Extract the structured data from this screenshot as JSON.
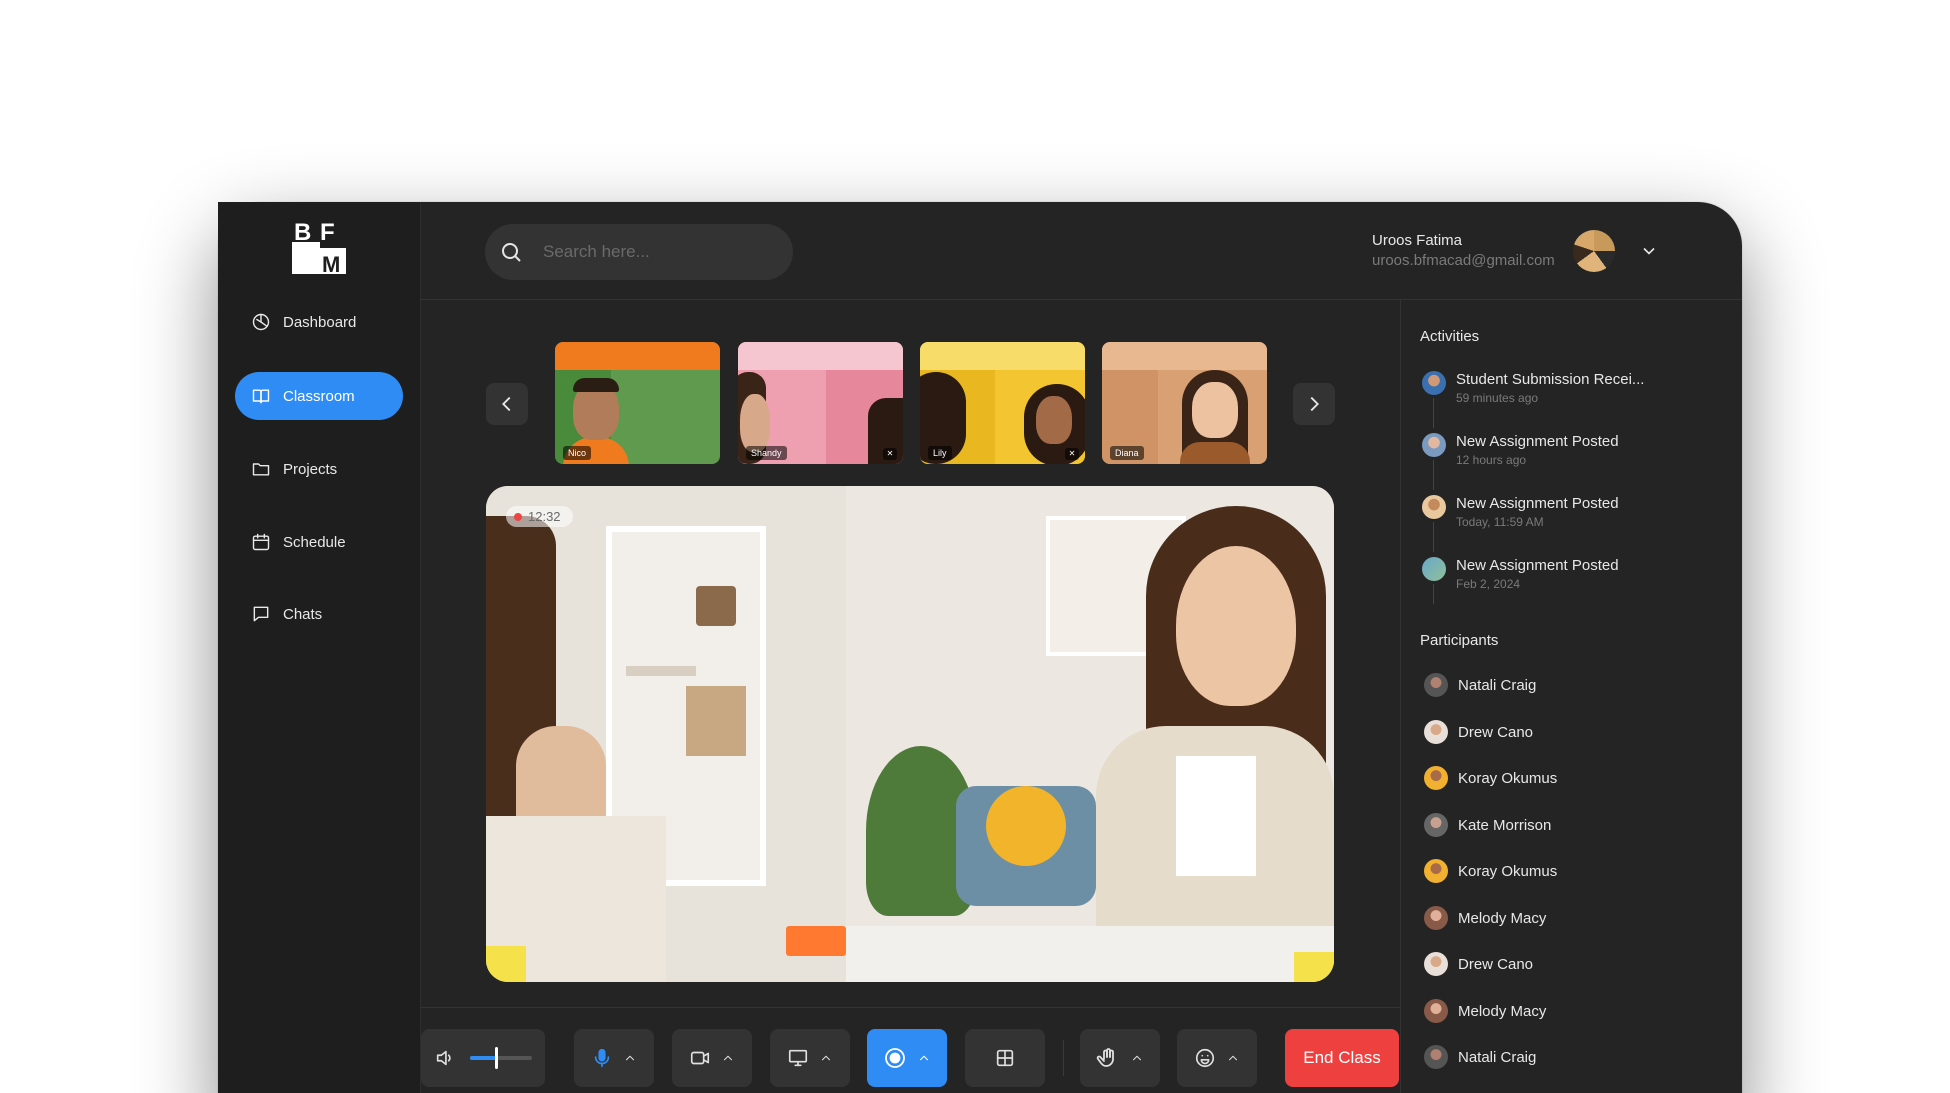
{
  "app": {
    "logo_alt": "BFM"
  },
  "sidebar": {
    "items": [
      {
        "label": "Dashboard",
        "icon": "dashboard-icon",
        "active": false
      },
      {
        "label": "Classroom",
        "icon": "book-icon",
        "active": true
      },
      {
        "label": "Projects",
        "icon": "folder-icon",
        "active": false
      },
      {
        "label": "Schedule",
        "icon": "calendar-icon",
        "active": false
      },
      {
        "label": "Chats",
        "icon": "chat-icon",
        "active": false
      }
    ]
  },
  "header": {
    "search_placeholder": "Search here...",
    "user_name": "Uroos Fatima",
    "user_email": "uroos.bfmacad@gmail.com"
  },
  "thumbnails": [
    {
      "name": "Nico",
      "color": "#5f9a4e",
      "accent": "#f07a1e",
      "muted": false
    },
    {
      "name": "Shandy",
      "color": "#ee9fb0",
      "accent": "#f5c6d0",
      "muted": true
    },
    {
      "name": "Lily",
      "color": "#f3c531",
      "accent": "#f8dc6a",
      "muted": true
    },
    {
      "name": "Diana",
      "color": "#d9a074",
      "accent": "#e8b890",
      "muted": false
    }
  ],
  "main_video": {
    "recording_time": "12:32"
  },
  "activities": {
    "title": "Activities",
    "items": [
      {
        "title": "Student Submission Recei...",
        "time": "59 minutes ago"
      },
      {
        "title": "New Assignment Posted",
        "time": "12 hours ago"
      },
      {
        "title": "New Assignment Posted",
        "time": "Today, 11:59 AM"
      },
      {
        "title": "New Assignment Posted",
        "time": "Feb 2, 2024"
      }
    ]
  },
  "participants": {
    "title": "Participants",
    "items": [
      "Natali Craig",
      "Drew Cano",
      "Koray Okumus",
      "Kate Morrison",
      "Koray Okumus",
      "Melody Macy",
      "Drew Cano",
      "Melody Macy",
      "Natali Craig"
    ]
  },
  "controls": {
    "volume_level": 0.42,
    "end_label": "End Class",
    "accent": "#2f8cf5",
    "danger": "#ef4040"
  }
}
